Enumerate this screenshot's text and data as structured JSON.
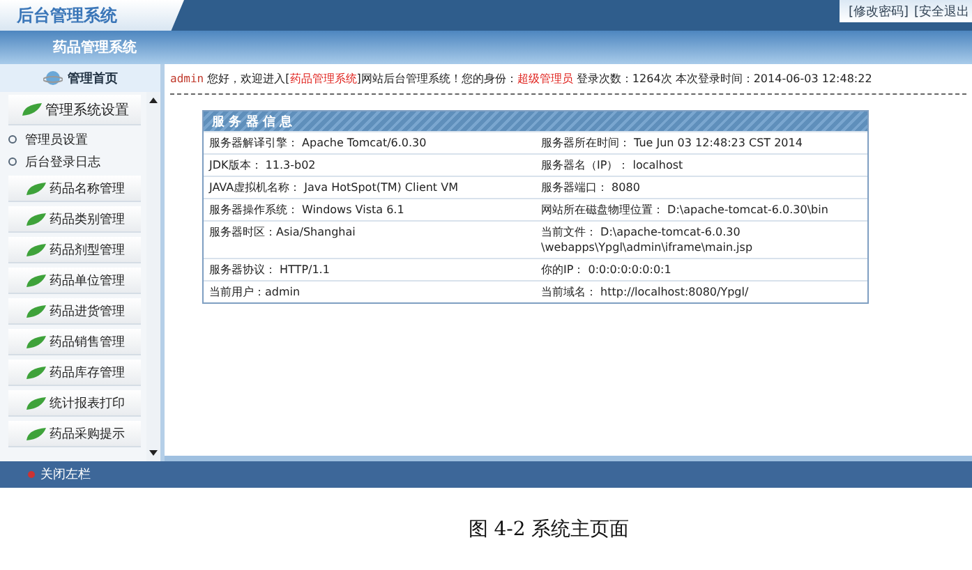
{
  "header": {
    "logo": "后台管理系统",
    "links": [
      "[修改密码]",
      "[安全退出"
    ],
    "system_title": "药品管理系统"
  },
  "sidebar": {
    "home": "管理首页",
    "section": "管理系统设置",
    "sub_items": [
      "管理员设置",
      "后台登录日志"
    ],
    "items": [
      "药品名称管理",
      "药品类别管理",
      "药品剂型管理",
      "药品单位管理",
      "药品进货管理",
      "药品销售管理",
      "药品库存管理",
      "统计报表打印",
      "药品采购提示"
    ]
  },
  "welcome": {
    "user": "admin",
    "text": "您好，欢迎进入[",
    "system": "药品管理系统",
    "text2": "]网站后台管理系统！您的身份：",
    "role": "超级管理员",
    "stats": "登录次数：1264次 本次登录时间：2014-06-03 12:48:22"
  },
  "server_info": {
    "title": "服 务 器 信 息",
    "rows": [
      [
        "服务器解译引擎： Apache Tomcat/6.0.30",
        "服务器所在时间： Tue Jun 03 12:48:23 CST 2014"
      ],
      [
        "JDK版本： 11.3-b02",
        "服务器名（IP）： localhost"
      ],
      [
        "JAVA虚拟机名称： Java HotSpot(TM) Client VM",
        "服务器端口： 8080"
      ],
      [
        "服务器操作系统： Windows Vista 6.1",
        "网站所在磁盘物理位置： D:\\apache-tomcat-6.0.30\\bin"
      ],
      [
        "服务器时区：Asia/Shanghai",
        "当前文件： D:\\apache-tomcat-6.0.30\n\\webapps\\Ypgl\\admin\\iframe\\main.jsp"
      ],
      [
        "服务器协议： HTTP/1.1",
        "你的IP： 0:0:0:0:0:0:0:1"
      ],
      [
        "当前用户：admin",
        "当前域名： http://localhost:8080/Ypgl/"
      ]
    ]
  },
  "footer": {
    "close_sidebar": "关闭左栏"
  },
  "caption": "图 4-2 系统主页面"
}
